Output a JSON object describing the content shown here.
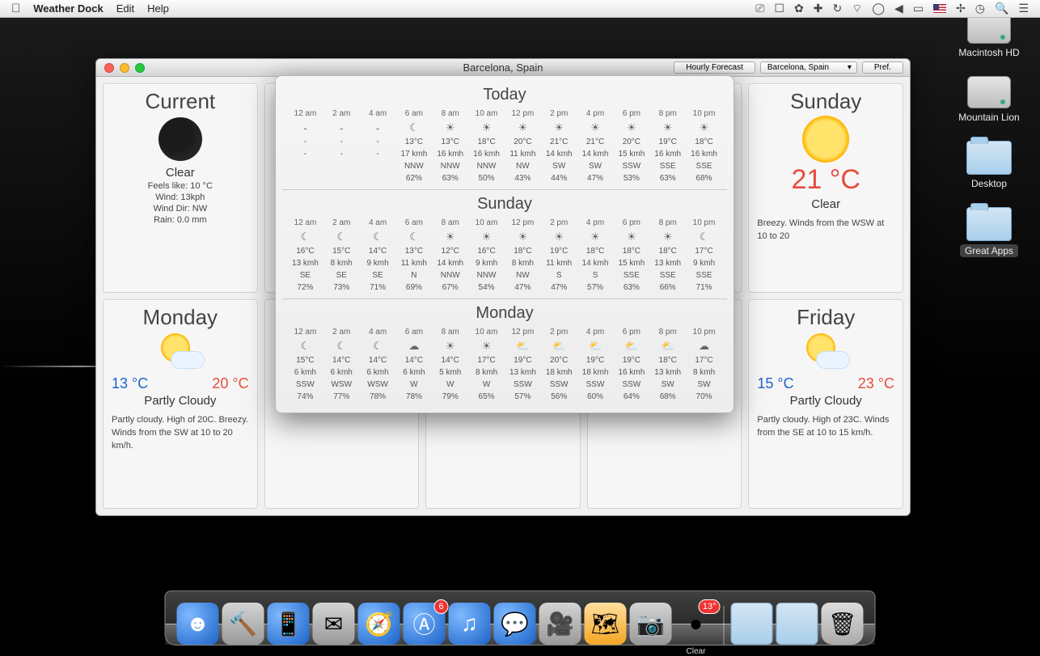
{
  "menubar": {
    "app": "Weather Dock",
    "items": [
      "Edit",
      "Help"
    ]
  },
  "desktop_icons": [
    {
      "name": "Macintosh HD",
      "type": "hd"
    },
    {
      "name": "Mountain Lion",
      "type": "hd"
    },
    {
      "name": "Desktop",
      "type": "folder"
    },
    {
      "name": "Great Apps",
      "type": "folder",
      "selected": true
    }
  ],
  "dock": {
    "items": [
      {
        "name": "Finder",
        "glyph": "☻",
        "cls": "blue"
      },
      {
        "name": "Xcode",
        "glyph": "🔨",
        "cls": "gray"
      },
      {
        "name": "iTunes Connect",
        "glyph": "📱",
        "cls": "blue"
      },
      {
        "name": "Mail",
        "glyph": "✉",
        "cls": "gray"
      },
      {
        "name": "Safari",
        "glyph": "🧭",
        "cls": "blue"
      },
      {
        "name": "App Store",
        "glyph": "Ⓐ",
        "cls": "blue",
        "badge": "6"
      },
      {
        "name": "iTunes",
        "glyph": "♫",
        "cls": "blue"
      },
      {
        "name": "Messages",
        "glyph": "💬",
        "cls": "blue"
      },
      {
        "name": "FaceTime",
        "glyph": "🎥",
        "cls": "gray"
      },
      {
        "name": "Maps",
        "glyph": "🗺",
        "cls": "orange"
      },
      {
        "name": "Photo Booth",
        "glyph": "📷",
        "cls": "gray"
      },
      {
        "name": "Weather Dock",
        "glyph": "●",
        "cls": "",
        "badge": "13°",
        "label": "Clear"
      }
    ],
    "folders": [
      {
        "name": "Documents"
      },
      {
        "name": "Downloads"
      }
    ],
    "trash": "Trash"
  },
  "window": {
    "title": "Barcelona, Spain",
    "hourly_button": "Hourly Forecast",
    "location_select": "Barcelona, Spain",
    "pref_button": "Pref."
  },
  "cards": {
    "current": {
      "title": "Current",
      "condition": "Clear",
      "feels_label": "Feels like:",
      "feels": "10 °C",
      "wind_label": "Wind:",
      "wind": "13kph",
      "winddir_label": "Wind Dir:",
      "winddir": "NW",
      "rain_label": "Rain:",
      "rain": "0.0 mm"
    },
    "sunday": {
      "title": "Sunday",
      "temp": "21 °C",
      "condition": "Clear",
      "desc": "Breezy. Winds from the WSW at 10 to 20"
    },
    "monday": {
      "title": "Monday",
      "low": "13 °C",
      "high": "20 °C",
      "condition": "Partly Cloudy",
      "desc": "Partly cloudy. High of 20C. Breezy. Winds from the SW at 10 to 20 km/h."
    },
    "friday": {
      "title": "Friday",
      "low": "15 °C",
      "high": "23 °C",
      "condition": "Partly Cloudy",
      "desc": "Partly cloudy. High of 23C. Winds from the SE at 10 to 15 km/h."
    }
  },
  "hourly": {
    "times": [
      "12 am",
      "2 am",
      "4 am",
      "6 am",
      "8 am",
      "10 am",
      "12 pm",
      "2 pm",
      "4 pm",
      "6 pm",
      "8 pm",
      "10 pm"
    ],
    "days": [
      {
        "name": "Today",
        "icon": [
          "-",
          "-",
          "-",
          "☾",
          "☀",
          "☀",
          "☀",
          "☀",
          "☀",
          "☀",
          "☀",
          "☀"
        ],
        "temp": [
          "-",
          "-",
          "-",
          "13°C",
          "13°C",
          "18°C",
          "20°C",
          "21°C",
          "21°C",
          "20°C",
          "19°C",
          "18°C"
        ],
        "wind": [
          "-",
          "-",
          "-",
          "17 kmh",
          "16 kmh",
          "16 kmh",
          "11 kmh",
          "14 kmh",
          "14 kmh",
          "15 kmh",
          "16 kmh",
          "16 kmh"
        ],
        "dir": [
          "",
          "",
          "",
          "NNW",
          "NNW",
          "NNW",
          "NW",
          "SW",
          "SW",
          "SSW",
          "SSE",
          "SSE"
        ],
        "hum": [
          "",
          "",
          "",
          "62%",
          "63%",
          "50%",
          "43%",
          "44%",
          "47%",
          "53%",
          "63%",
          "68%"
        ],
        "past": [
          true,
          true,
          true,
          false,
          false,
          false,
          false,
          false,
          false,
          false,
          false,
          false
        ]
      },
      {
        "name": "Sunday",
        "icon": [
          "☾",
          "☾",
          "☾",
          "☾",
          "☀",
          "☀",
          "☀",
          "☀",
          "☀",
          "☀",
          "☀",
          "☾"
        ],
        "temp": [
          "16°C",
          "15°C",
          "14°C",
          "13°C",
          "12°C",
          "16°C",
          "18°C",
          "19°C",
          "18°C",
          "18°C",
          "18°C",
          "17°C"
        ],
        "wind": [
          "13 kmh",
          "8 kmh",
          "9 kmh",
          "11 kmh",
          "14 kmh",
          "9 kmh",
          "8 kmh",
          "11 kmh",
          "14 kmh",
          "15 kmh",
          "13 kmh",
          "9 kmh"
        ],
        "dir": [
          "SE",
          "SE",
          "SE",
          "N",
          "NNW",
          "NNW",
          "NW",
          "S",
          "S",
          "SSE",
          "SSE",
          "SSE"
        ],
        "hum": [
          "72%",
          "73%",
          "71%",
          "69%",
          "67%",
          "54%",
          "47%",
          "47%",
          "57%",
          "63%",
          "66%",
          "71%"
        ]
      },
      {
        "name": "Monday",
        "icon": [
          "☾",
          "☾",
          "☾",
          "☁",
          "☀",
          "☀",
          "⛅",
          "⛅",
          "⛅",
          "⛅",
          "⛅",
          "☁"
        ],
        "temp": [
          "15°C",
          "14°C",
          "14°C",
          "14°C",
          "14°C",
          "17°C",
          "19°C",
          "20°C",
          "19°C",
          "19°C",
          "18°C",
          "17°C"
        ],
        "wind": [
          "6 kmh",
          "6 kmh",
          "6 kmh",
          "6 kmh",
          "5 kmh",
          "8 kmh",
          "13 kmh",
          "18 kmh",
          "18 kmh",
          "16 kmh",
          "13 kmh",
          "8 kmh"
        ],
        "dir": [
          "SSW",
          "WSW",
          "WSW",
          "W",
          "W",
          "W",
          "SSW",
          "SSW",
          "SSW",
          "SSW",
          "SW",
          "SW"
        ],
        "hum": [
          "74%",
          "77%",
          "78%",
          "78%",
          "79%",
          "65%",
          "57%",
          "56%",
          "60%",
          "64%",
          "68%",
          "70%"
        ]
      }
    ]
  }
}
